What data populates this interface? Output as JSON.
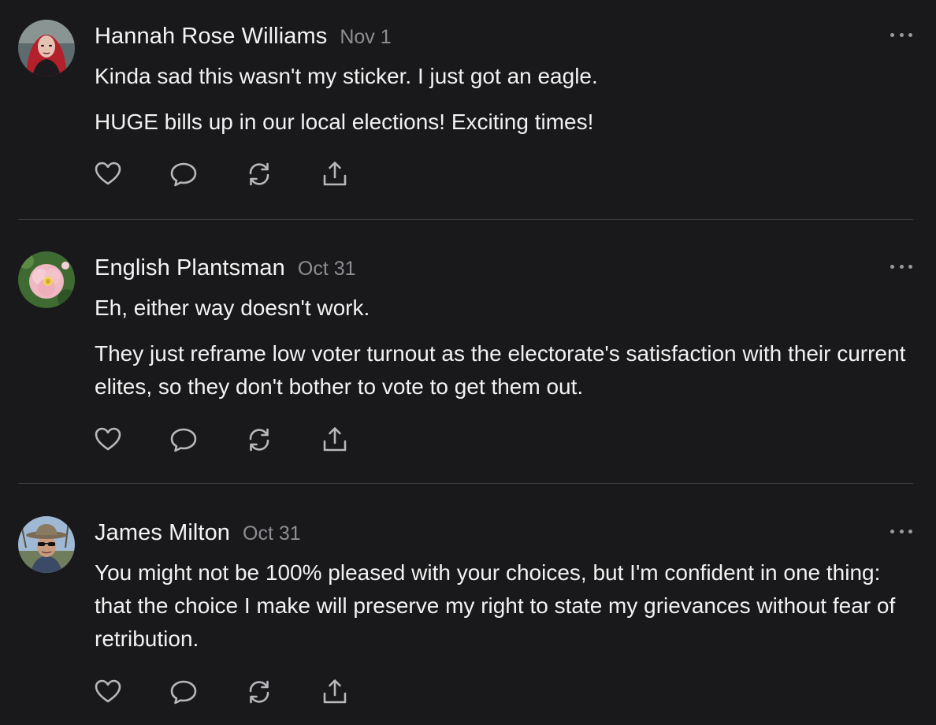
{
  "colors": {
    "background": "#19191b",
    "text": "#f2f2f2",
    "muted": "#8e8e93",
    "divider": "#3a3a3d"
  },
  "icons": {
    "like": "heart-icon",
    "reply": "speech-bubble-icon",
    "restack": "restack-arrows-icon",
    "share": "share-upload-icon",
    "more": "more-dots-icon"
  },
  "comments": [
    {
      "author": "Hannah Rose Williams",
      "date": "Nov 1",
      "paragraphs": [
        "Kinda sad this wasn't my sticker. I just got an eagle.",
        "HUGE bills up in our local elections! Exciting times!"
      ]
    },
    {
      "author": "English Plantsman",
      "date": "Oct 31",
      "paragraphs": [
        "Eh, either way doesn't work.",
        "They just reframe low voter turnout as the electorate's satisfaction with their current elites, so they don't bother to vote to get them out."
      ]
    },
    {
      "author": "James Milton",
      "date": "Oct 31",
      "paragraphs": [
        "You might not be 100% pleased with your choices,  but I'm confident in one thing: that the choice I make will preserve my right to state my grievances without fear of retribution."
      ]
    }
  ]
}
